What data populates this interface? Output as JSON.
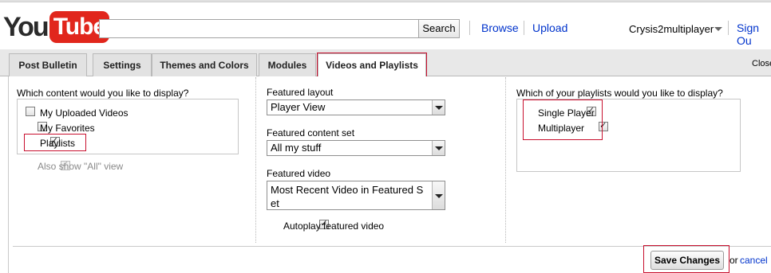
{
  "header": {
    "logo_you": "You",
    "logo_tube": "Tube",
    "search": {
      "value": "",
      "button_label": "Search"
    },
    "links": {
      "browse": "Browse",
      "upload": "Upload"
    },
    "username": "Crysis2multiplayer",
    "sign_out": "Sign Ou"
  },
  "tabs": [
    {
      "label": "Post Bulletin",
      "active": false
    },
    {
      "label": "Settings",
      "active": false
    },
    {
      "label": "Themes and Colors",
      "active": false
    },
    {
      "label": "Modules",
      "active": false
    },
    {
      "label": "Videos and Playlists",
      "active": true
    }
  ],
  "close_label": "Close",
  "content_column": {
    "question": "Which content would you like to display?",
    "options": [
      {
        "label": "My Uploaded Videos",
        "checked": false
      },
      {
        "label": "My Favorites",
        "checked": false
      },
      {
        "label": "Playlists",
        "checked": true
      }
    ],
    "show_all": {
      "label": "Also show \"All\" view",
      "checked": true,
      "disabled": true
    }
  },
  "featured_column": {
    "layout": {
      "label": "Featured layout",
      "value": "Player View"
    },
    "content_set": {
      "label": "Featured content set",
      "value": "All my stuff"
    },
    "video": {
      "label": "Featured video",
      "value_line1": "Most Recent Video in Featured S",
      "value_line2": "et"
    },
    "autoplay": {
      "label": "Autoplay featured video",
      "checked": true
    }
  },
  "playlists_column": {
    "question": "Which of your playlists would you like to display?",
    "items": [
      {
        "label": "Single Player",
        "checked": true
      },
      {
        "label": "Multiplayer",
        "checked": true
      }
    ]
  },
  "footer": {
    "save_label": "Save Changes",
    "or_text": "or",
    "cancel_label": "cancel"
  },
  "colors": {
    "link": "#0033cc",
    "highlight_box": "#c8102e",
    "logo_red": "#e1261c"
  }
}
